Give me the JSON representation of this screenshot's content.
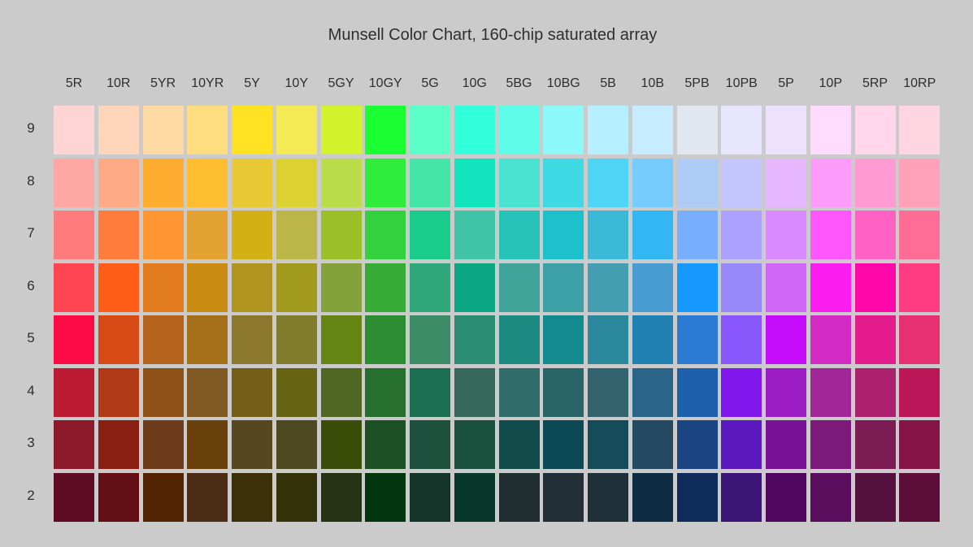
{
  "chart_data": {
    "type": "heatmap",
    "title": "Munsell Color Chart, 160-chip saturated array",
    "columns": [
      "5R",
      "10R",
      "5YR",
      "10YR",
      "5Y",
      "10Y",
      "5GY",
      "10GY",
      "5G",
      "10G",
      "5BG",
      "10BG",
      "5B",
      "10B",
      "5PB",
      "10PB",
      "5P",
      "10P",
      "5RP",
      "10RP"
    ],
    "rows": [
      {
        "value": "9",
        "colors": [
          "#fed5d2",
          "#ffd6bb",
          "#ffd9a4",
          "#ffdd80",
          "#ffe322",
          "#f3ea55",
          "#d3f42c",
          "#1aff32",
          "#5cffc8",
          "#34ffdb",
          "#5ffde9",
          "#8cf8f8",
          "#b6efff",
          "#c7ebff",
          "#e1e6f1",
          "#e6e6fe",
          "#ede2fe",
          "#ffdcff",
          "#ffd6ea",
          "#ffd6e0"
        ]
      },
      {
        "value": "8",
        "colors": [
          "#ffa8a3",
          "#ffaa86",
          "#ffad30",
          "#ffbd30",
          "#e9c836",
          "#dbd232",
          "#b9dc48",
          "#30ed3c",
          "#45e5a8",
          "#13e6be",
          "#4ae2d1",
          "#3ed9e3",
          "#4fd6f6",
          "#77ccff",
          "#aecbf6",
          "#c6c6fe",
          "#e6b6ff",
          "#fc9bfa",
          "#ff9bd2",
          "#ffa2b9"
        ]
      },
      {
        "value": "7",
        "colors": [
          "#ff7b7c",
          "#ff7c3a",
          "#ff9632",
          "#e4a233",
          "#d3b014",
          "#bcb548",
          "#9abf27",
          "#32d13d",
          "#1acc8c",
          "#41c3a7",
          "#27c3b9",
          "#1dc1cc",
          "#3cb9d7",
          "#33b7f2",
          "#78aefc",
          "#aca1fe",
          "#d98aff",
          "#ff56fd",
          "#ff61c4",
          "#ff6c96"
        ]
      },
      {
        "value": "6",
        "colors": [
          "#fe4551",
          "#ff5d18",
          "#e27b1d",
          "#ca8b12",
          "#b0941f",
          "#a19a1c",
          "#83a23b",
          "#36ac36",
          "#2ea87a",
          "#0ba684",
          "#40a49b",
          "#3ca0a6",
          "#469eb3",
          "#489cd2",
          "#1699ff",
          "#9888fa",
          "#d066f8",
          "#fc1ef1",
          "#ff08aa",
          "#ff3c81"
        ]
      },
      {
        "value": "5",
        "colors": [
          "#fc0b45",
          "#d84a15",
          "#b5621c",
          "#a6701a",
          "#8c782c",
          "#817c2c",
          "#648414",
          "#2d8d32",
          "#3d8d69",
          "#2a8d72",
          "#1c8a80",
          "#138a8e",
          "#2b879c",
          "#2281b3",
          "#2b7bd5",
          "#8a57fd",
          "#c60afa",
          "#d42ac4",
          "#e31b8d",
          "#e73070"
        ]
      },
      {
        "value": "4",
        "colors": [
          "#bc1b33",
          "#b03a15",
          "#8e5219",
          "#815a23",
          "#755f17",
          "#666412",
          "#506623",
          "#266f2f",
          "#1b6e51",
          "#366859",
          "#306c69",
          "#296567",
          "#33636f",
          "#2a6489",
          "#1f60ac",
          "#8017ec",
          "#9b1dc3",
          "#a12698",
          "#ab216e",
          "#bb1758"
        ]
      },
      {
        "value": "3",
        "colors": [
          "#8c1a2b",
          "#891f10",
          "#6e3c1a",
          "#6a410c",
          "#574721",
          "#4f4921",
          "#3a4e0a",
          "#1d5124",
          "#1f513f",
          "#19513e",
          "#114b4c",
          "#0c4954",
          "#154c5a",
          "#254960",
          "#1b4482",
          "#5d19c0",
          "#7a1197",
          "#7d1979",
          "#7e1d55",
          "#851546"
        ]
      },
      {
        "value": "2",
        "colors": [
          "#5d0c23",
          "#630f14",
          "#522404",
          "#4a2d14",
          "#3d2f07",
          "#343208",
          "#273413",
          "#00350d",
          "#15352a",
          "#073729",
          "#212e32",
          "#222f36",
          "#203038",
          "#0e2c43",
          "#0f2b5a",
          "#3c1676",
          "#51075f",
          "#590d5c",
          "#56123f",
          "#5d0e38"
        ]
      }
    ]
  }
}
